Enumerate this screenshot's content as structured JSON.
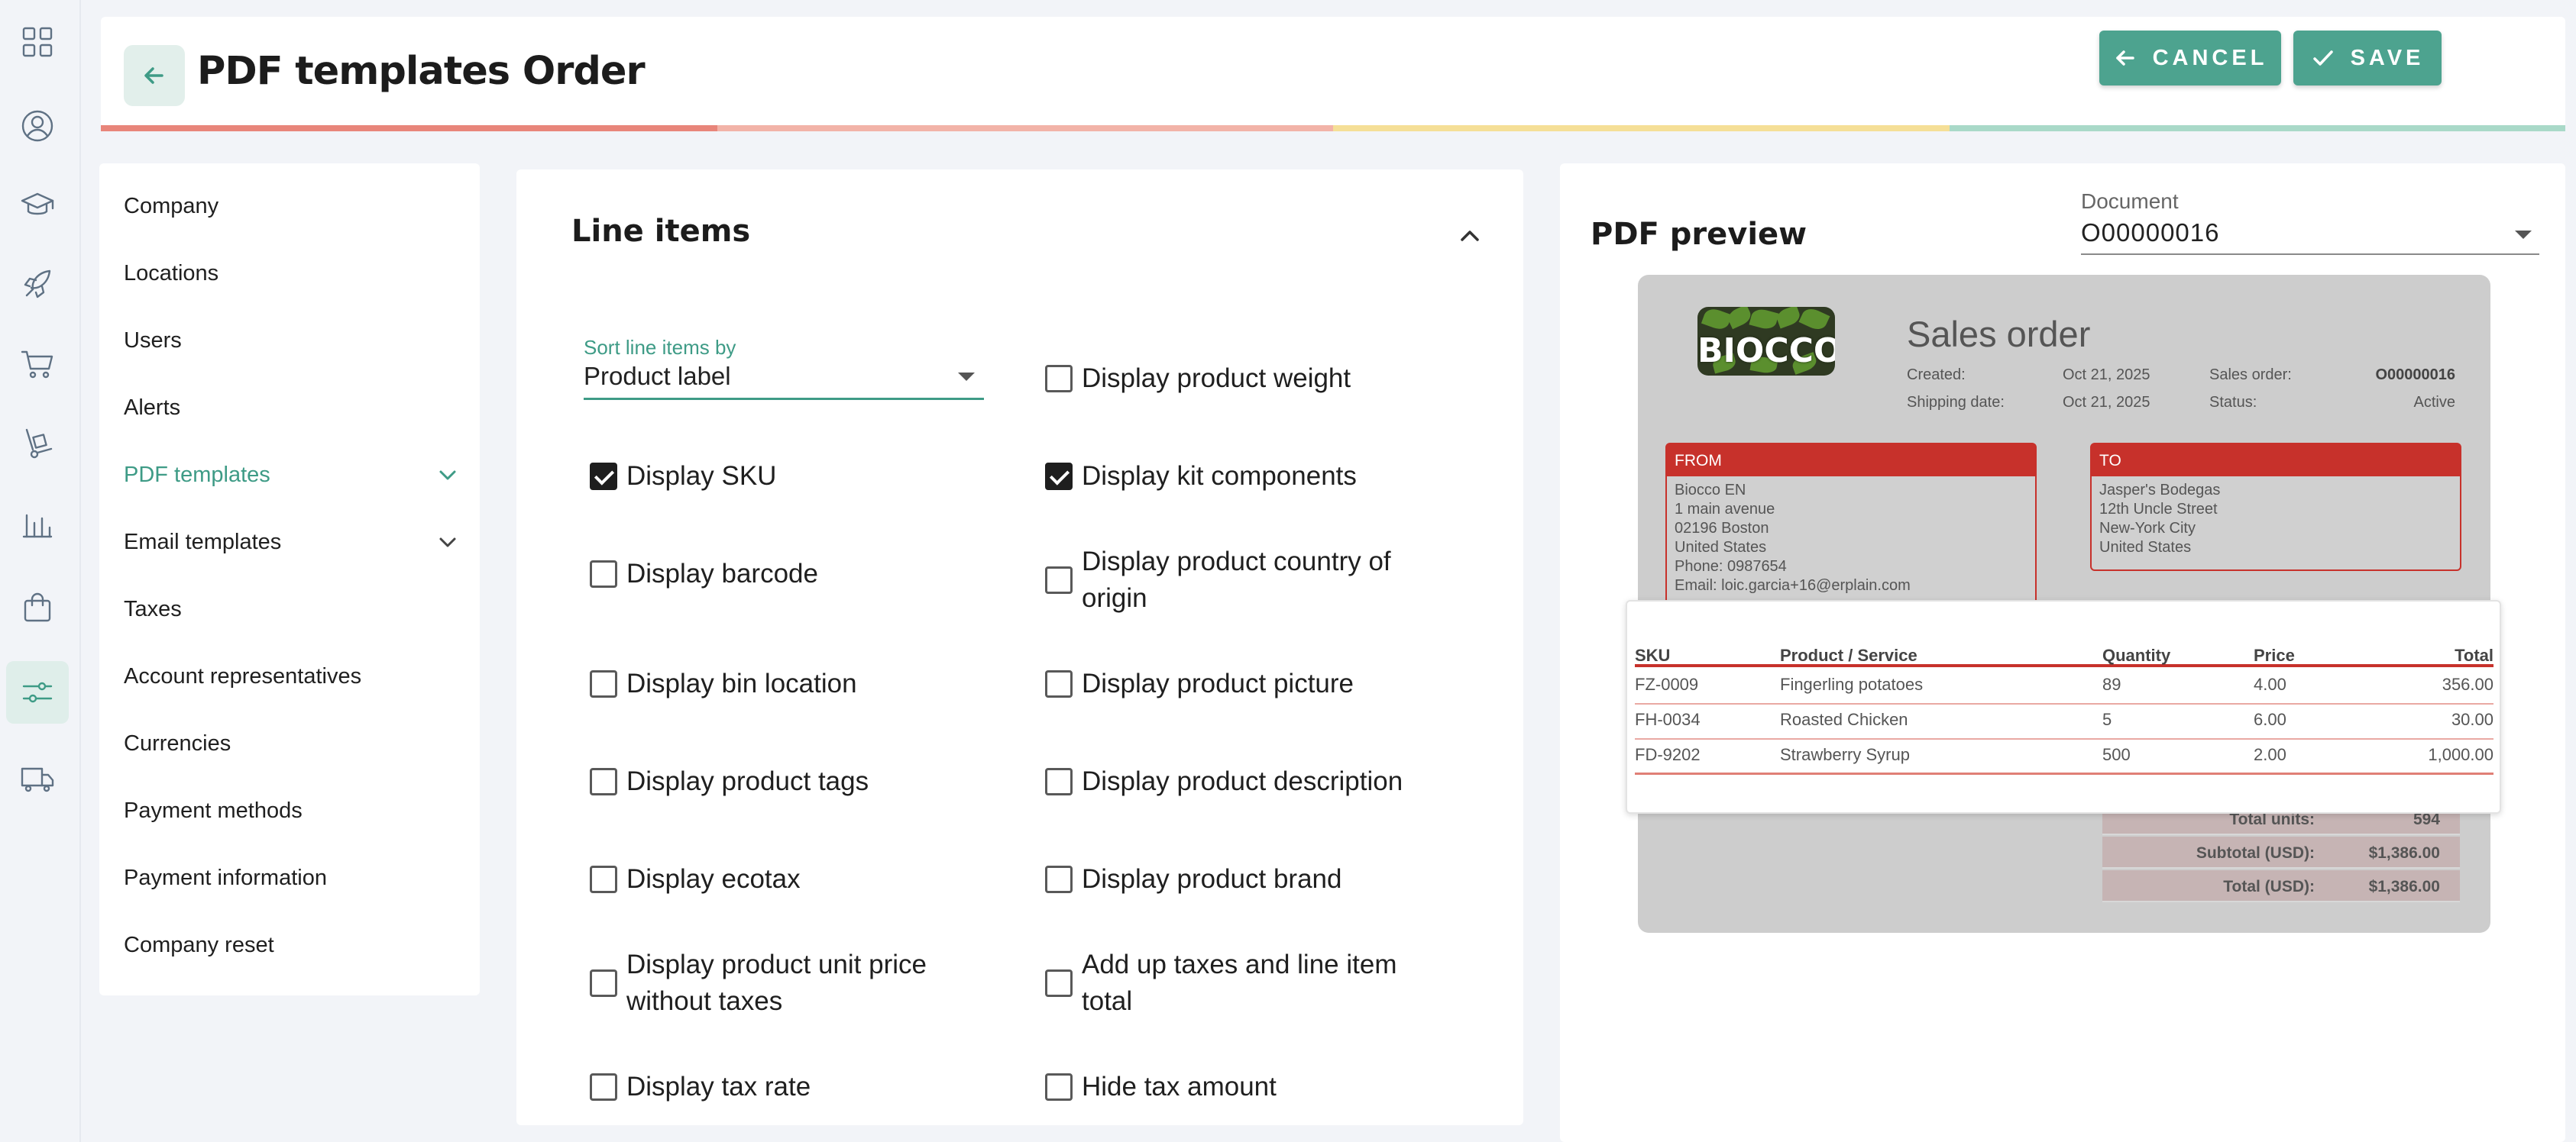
{
  "app": {
    "page_title": "PDF templates Order",
    "cancel_label": "CANCEL",
    "save_label": "SAVE",
    "accent_color": "#4da38f"
  },
  "rail_icons": [
    "grid-icon",
    "user-circle-icon",
    "graduation-cap-icon",
    "rocket-icon",
    "cart-icon",
    "hand-truck-icon",
    "bar-chart-icon",
    "shopping-bag-icon",
    "settings-sliders-icon",
    "truck-icon"
  ],
  "nav": {
    "items": [
      {
        "label": "Company"
      },
      {
        "label": "Locations"
      },
      {
        "label": "Users"
      },
      {
        "label": "Alerts"
      },
      {
        "label": "PDF templates",
        "active": true,
        "expandable": true
      },
      {
        "label": "Email templates",
        "expandable": true
      },
      {
        "label": "Taxes"
      },
      {
        "label": "Account representatives"
      },
      {
        "label": "Currencies"
      },
      {
        "label": "Payment methods"
      },
      {
        "label": "Payment information"
      },
      {
        "label": "Company reset"
      }
    ]
  },
  "line_items": {
    "title": "Line items",
    "sort_label": "Sort line items by",
    "sort_value": "Product label",
    "options": [
      {
        "label": "Display product weight",
        "checked": false
      },
      {
        "label": "Display SKU",
        "checked": true
      },
      {
        "label": "Display kit components",
        "checked": true
      },
      {
        "label": "Display barcode",
        "checked": false
      },
      {
        "label": "Display product country of origin",
        "checked": false
      },
      {
        "label": "Display bin location",
        "checked": false
      },
      {
        "label": "Display product picture",
        "checked": false
      },
      {
        "label": "Display product tags",
        "checked": false
      },
      {
        "label": "Display product description",
        "checked": false
      },
      {
        "label": "Display ecotax",
        "checked": false
      },
      {
        "label": "Display product brand",
        "checked": false
      },
      {
        "label": "Display product unit price without taxes",
        "checked": false
      },
      {
        "label": "Add up taxes and line item total",
        "checked": false
      },
      {
        "label": "Display tax rate",
        "checked": false
      },
      {
        "label": "Hide tax amount",
        "checked": false
      }
    ]
  },
  "preview": {
    "title": "PDF preview",
    "document_label": "Document",
    "document_value": "O00000016",
    "logo_text": "BIOCCO",
    "doc_title": "Sales order",
    "meta": {
      "created_label": "Created:",
      "created_value": "Oct 21, 2025",
      "shipping_label": "Shipping date:",
      "shipping_value": "Oct 21, 2025",
      "order_label": "Sales order:",
      "order_value": "O00000016",
      "status_label": "Status:",
      "status_value": "Active"
    },
    "from": {
      "heading": "FROM",
      "lines": [
        "Biocco EN",
        "1 main avenue",
        "02196 Boston",
        "United States",
        "Phone: 0987654",
        "Email: loic.garcia+16@erplain.com"
      ]
    },
    "to": {
      "heading": "TO",
      "lines": [
        "Jasper's Bodegas",
        "12th Uncle Street",
        "New-York City",
        "United States"
      ]
    },
    "table": {
      "headers": [
        "SKU",
        "Product / Service",
        "Quantity",
        "Price",
        "Total"
      ],
      "rows": [
        [
          "FZ-0009",
          "Fingerling potatoes",
          "89",
          "4.00",
          "356.00"
        ],
        [
          "FH-0034",
          "Roasted Chicken",
          "5",
          "6.00",
          "30.00"
        ],
        [
          "FD-9202",
          "Strawberry Syrup",
          "500",
          "2.00",
          "1,000.00"
        ]
      ]
    },
    "totals": [
      {
        "label": "Total units:",
        "value": "594"
      },
      {
        "label": "Subtotal (USD):",
        "value": "$1,386.00"
      },
      {
        "label": "Total (USD):",
        "value": "$1,386.00"
      }
    ],
    "brand_color": "#c7312b"
  }
}
